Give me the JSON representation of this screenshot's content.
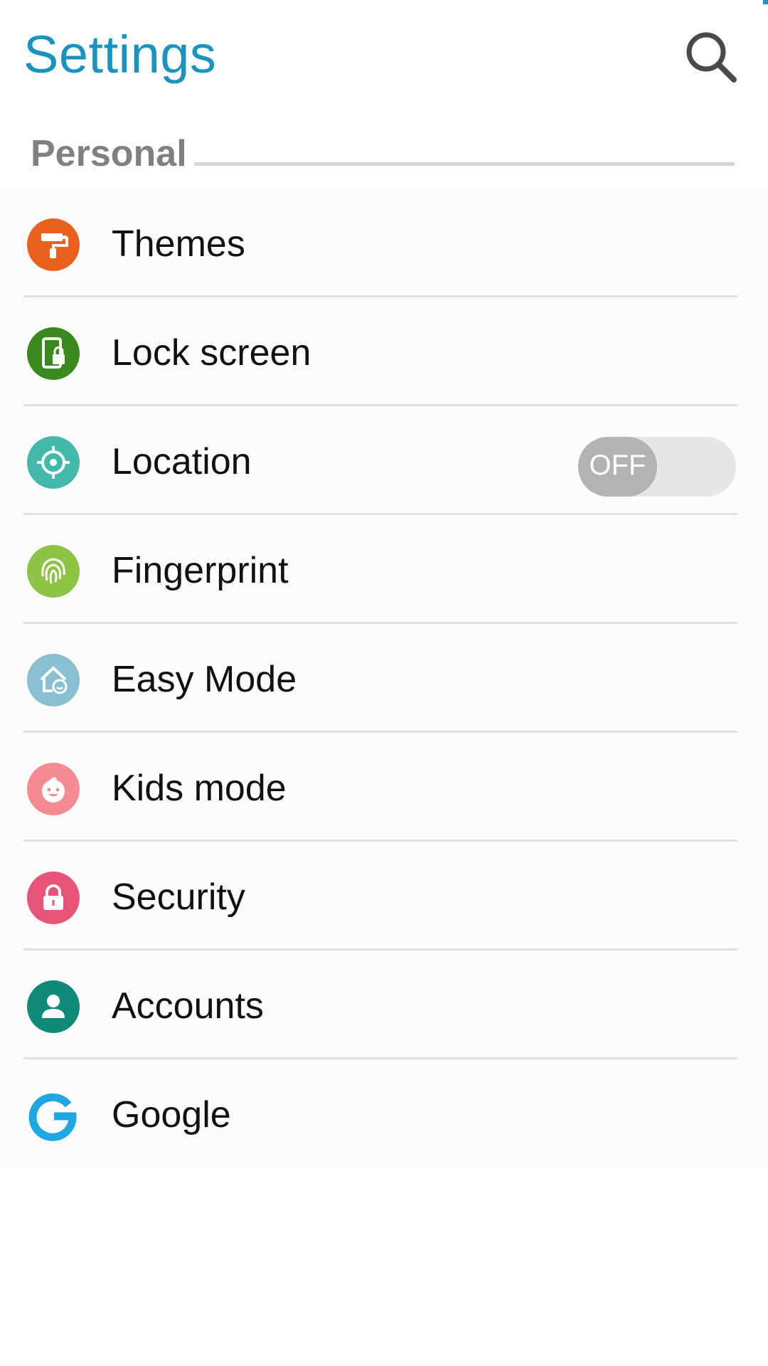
{
  "header": {
    "title": "Settings",
    "search_icon": "search-icon"
  },
  "colors": {
    "accent": "#1a93bf",
    "section_label": "#808080",
    "text": "#111111",
    "divider": "#e0e0e0"
  },
  "section": {
    "label": "Personal"
  },
  "items": [
    {
      "label": "Themes",
      "icon": "paint-roller-icon",
      "color": "#e9621d"
    },
    {
      "label": "Lock screen",
      "icon": "phone-lock-icon",
      "color": "#3b8a1f"
    },
    {
      "label": "Location",
      "icon": "crosshair-icon",
      "color": "#45b8ac",
      "toggle": {
        "state": "OFF"
      }
    },
    {
      "label": "Fingerprint",
      "icon": "fingerprint-icon",
      "color": "#8dc445"
    },
    {
      "label": "Easy Mode",
      "icon": "house-smile-icon",
      "color": "#88bfd1"
    },
    {
      "label": "Kids mode",
      "icon": "kid-face-icon",
      "color": "#f58a93"
    },
    {
      "label": "Security",
      "icon": "padlock-icon",
      "color": "#e8537a"
    },
    {
      "label": "Accounts",
      "icon": "person-icon",
      "color": "#0f8a78"
    },
    {
      "label": "Google",
      "icon": "google-g-icon",
      "color": "#1fa7e4"
    }
  ]
}
